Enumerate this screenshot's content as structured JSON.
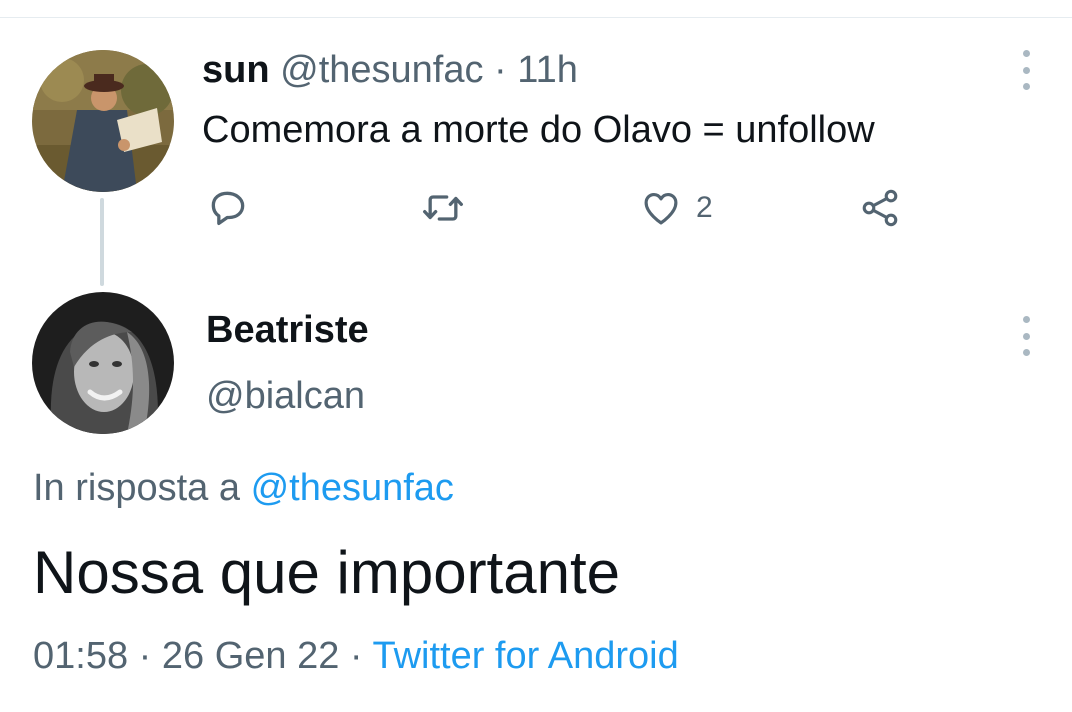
{
  "parent_tweet": {
    "display_name": "sun",
    "handle": "@thesunfac",
    "separator": "·",
    "time_ago": "11h",
    "text": "Comemora a morte do Olavo = unfollow",
    "avatar_icon": "painting-avatar",
    "actions": {
      "reply_icon": "reply-icon",
      "retweet_icon": "retweet-icon",
      "like_icon": "heart-icon",
      "like_count": "2",
      "share_icon": "share-icon"
    },
    "more_icon": "more-vertical-icon"
  },
  "main_tweet": {
    "display_name": "Beatriste",
    "handle": "@bialcan",
    "avatar_icon": "portrait-avatar",
    "more_icon": "more-vertical-icon",
    "reply_prefix": "In risposta a",
    "reply_to": "@thesunfac",
    "text": "Nossa que importante",
    "time": "01:58",
    "separator": "·",
    "date": "26 Gen 22",
    "client": "Twitter for Android"
  },
  "colors": {
    "text": "#0f1419",
    "secondary": "#536471",
    "accent": "#1d9bf0",
    "thread_line": "#cfd9de"
  }
}
